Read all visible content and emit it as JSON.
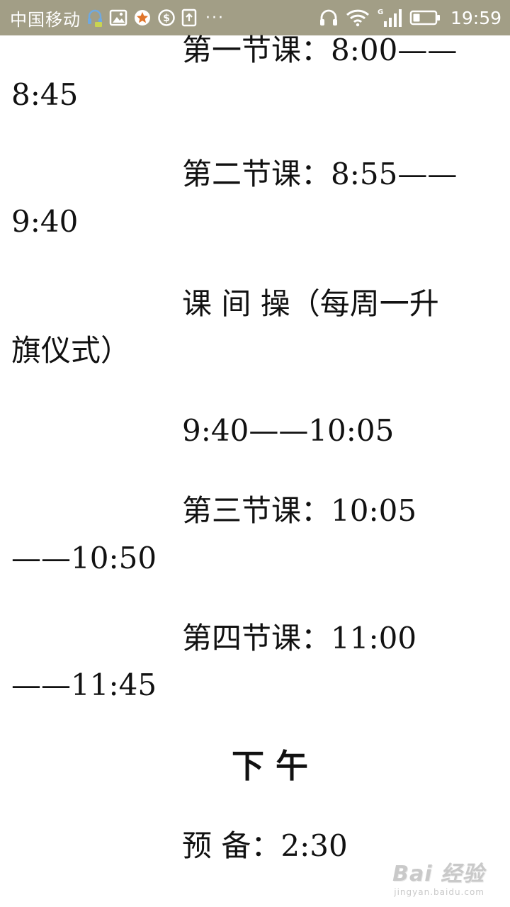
{
  "status_bar": {
    "carrier": "中国移动",
    "more": "···",
    "time": "19:59",
    "signal_type": "G",
    "icons": [
      "headset-icon",
      "image-icon",
      "star-badge-icon",
      "sync-icon",
      "upload-icon",
      "headphones-icon",
      "wifi-icon",
      "signal-icon",
      "battery-icon"
    ]
  },
  "schedule": {
    "period1_label": "第一节课：8:00——",
    "period1_end": "8:45",
    "period2_label": "第二节课：8:55——",
    "period2_end": "9:40",
    "exercise_label": "课  间  操（每周一升",
    "exercise_cont": "旗仪式）",
    "exercise_time": "9:40——10:05",
    "period3_label": "第三节课：10:05",
    "period3_end": "——10:50",
    "period4_label": "第四节课：11:00",
    "period4_end": "——11:45",
    "afternoon_heading": "下 午",
    "prep_label": "预 备：2:30"
  },
  "watermark": {
    "logo": "Bai 经验",
    "url": "jingyan.baidu.com"
  },
  "colors": {
    "status_bar_bg": "#a29e86",
    "text": "#111111",
    "watermark": "#c9c9c9"
  }
}
